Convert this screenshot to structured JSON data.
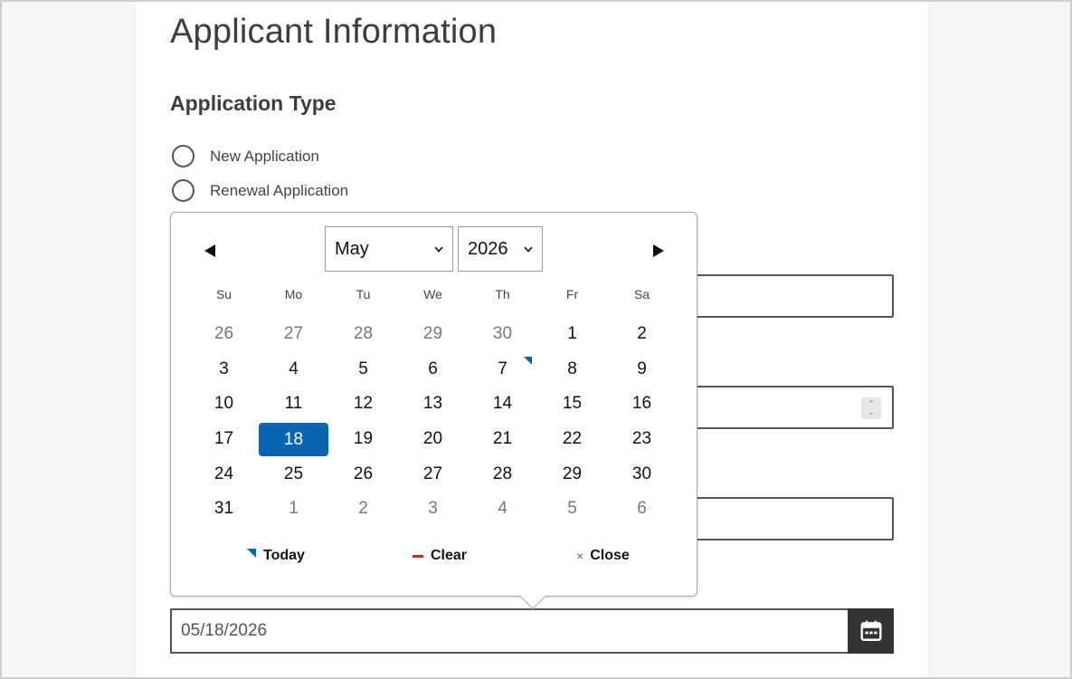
{
  "page": {
    "title": "Applicant Information",
    "section_title": "Application Type"
  },
  "application_type": {
    "options": [
      {
        "label": "New Application"
      },
      {
        "label": "Renewal Application"
      }
    ]
  },
  "date_field": {
    "value": "05/18/2026",
    "button_icon": "calendar-icon"
  },
  "datepicker": {
    "month": "May",
    "year": "2026",
    "prev_icon": "triangle-left-icon",
    "next_icon": "triangle-right-icon",
    "weekdays": [
      "Su",
      "Mo",
      "Tu",
      "We",
      "Th",
      "Fr",
      "Sa"
    ],
    "days": [
      {
        "label": "26",
        "muted": true
      },
      {
        "label": "27",
        "muted": true
      },
      {
        "label": "28",
        "muted": true
      },
      {
        "label": "29",
        "muted": true
      },
      {
        "label": "30",
        "muted": true
      },
      {
        "label": "1"
      },
      {
        "label": "2"
      },
      {
        "label": "3"
      },
      {
        "label": "4"
      },
      {
        "label": "5"
      },
      {
        "label": "6"
      },
      {
        "label": "7",
        "today": true
      },
      {
        "label": "8"
      },
      {
        "label": "9"
      },
      {
        "label": "10"
      },
      {
        "label": "11"
      },
      {
        "label": "12"
      },
      {
        "label": "13"
      },
      {
        "label": "14"
      },
      {
        "label": "15"
      },
      {
        "label": "16"
      },
      {
        "label": "17"
      },
      {
        "label": "18",
        "selected": true
      },
      {
        "label": "19"
      },
      {
        "label": "20"
      },
      {
        "label": "21"
      },
      {
        "label": "22"
      },
      {
        "label": "23"
      },
      {
        "label": "24"
      },
      {
        "label": "25"
      },
      {
        "label": "26"
      },
      {
        "label": "27"
      },
      {
        "label": "28"
      },
      {
        "label": "29"
      },
      {
        "label": "30"
      },
      {
        "label": "31"
      },
      {
        "label": "1",
        "muted": true
      },
      {
        "label": "2",
        "muted": true
      },
      {
        "label": "3",
        "muted": true
      },
      {
        "label": "4",
        "muted": true
      },
      {
        "label": "5",
        "muted": true
      },
      {
        "label": "6",
        "muted": true
      }
    ],
    "footer": {
      "today_label": "Today",
      "clear_label": "Clear",
      "close_label": "Close",
      "close_glyph": "×"
    }
  },
  "colors": {
    "accent": "#0b64b0",
    "clear": "#d0271d",
    "dark_button": "#333333"
  }
}
